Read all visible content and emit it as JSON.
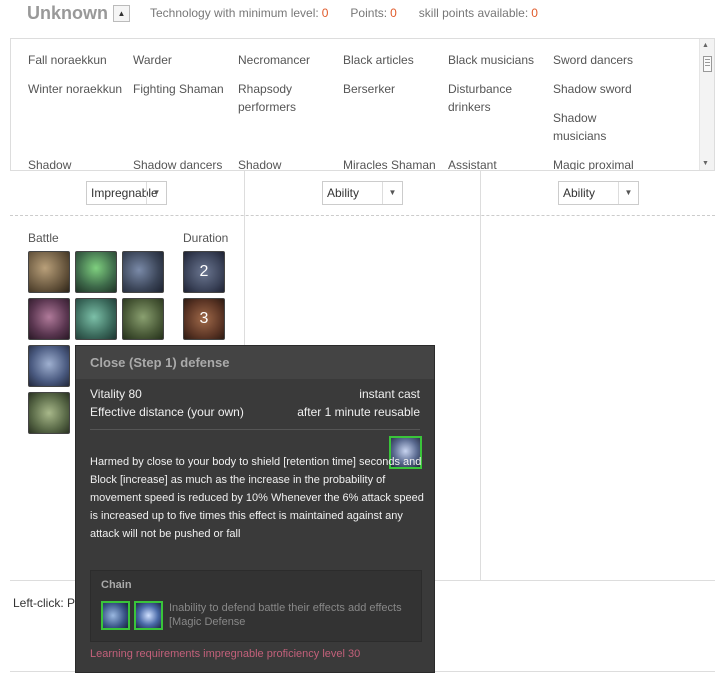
{
  "header": {
    "title": "Unknown",
    "toggle_glyph": "▲",
    "stats": [
      {
        "label": "Technology with minimum level:",
        "value": "0"
      },
      {
        "label": "Points:",
        "value": "0"
      },
      {
        "label": "skill points available:",
        "value": "0"
      }
    ]
  },
  "classes": {
    "row1": [
      "Fall noraekkun",
      "Warder",
      "Necromancer",
      "Black articles",
      "Black musicians",
      "Sword dancers"
    ],
    "row2": [
      "Winter noraekkun",
      "Fighting Shaman",
      "Rhapsody performers",
      "Berserker",
      "Disturbance drinkers",
      "Shadow sword"
    ],
    "row3": [
      "Shadow musicians"
    ],
    "row4": [
      "Shadow",
      "Shadow dancers",
      "Shadow",
      "Miracles Shaman",
      "Assistant",
      "Magic proximal"
    ]
  },
  "selects": [
    "Impregnable",
    "Ability",
    "Ability"
  ],
  "skill_panel": {
    "battle_label": "Battle",
    "duration_label": "Duration",
    "duration_levels": [
      "2",
      "3"
    ]
  },
  "footer": {
    "hint": "Left-click: Poi"
  },
  "tooltip": {
    "title": "Close (Step 1) defense",
    "vitality": "Vitality 80",
    "cast": "instant cast",
    "range": "Effective distance (your own)",
    "cooldown": "after 1 minute reusable",
    "description": "Harmed by close to your body to shield [retention time] seconds and Block [increase] as much as the increase in the probability of movement speed is reduced by 10% Whenever the 6% attack speed is increased up to five times this effect is maintained against any attack will not be pushed or fall",
    "chain_title": "Chain",
    "chain_text": "Inability to defend battle their effects add effects [Magic Defense",
    "requirement": "Learning requirements impregnable proficiency level 30"
  },
  "colors": {
    "accent": "#e05a2a",
    "requirement": "#c2607a",
    "chain_border": "#3ac43a"
  }
}
